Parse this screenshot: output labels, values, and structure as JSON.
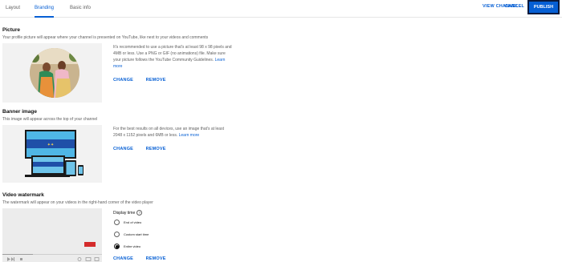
{
  "tabs": [
    {
      "label": "Layout",
      "active": false
    },
    {
      "label": "Branding",
      "active": true
    },
    {
      "label": "Basic info",
      "active": false
    }
  ],
  "top_actions": {
    "view_channel": "VIEW CHANNEL",
    "cancel": "CANCEL",
    "publish": "PUBLISH"
  },
  "picture": {
    "title": "Picture",
    "description": "Your profile picture will appear where your channel is presented on YouTube, like next to your videos and comments",
    "help": "It's recommended to use a picture that's at least 98 x 98 pixels and 4MB or less. Use a PNG or GIF (no animations) file. Make sure your picture follows the YouTube Community Guidelines.",
    "learn_more": "Learn more",
    "change": "CHANGE",
    "remove": "REMOVE"
  },
  "banner": {
    "title": "Banner image",
    "description": "This image will appear across the top of your channel",
    "help": "For the best results on all devices, use an image that's at least 2048 x 1152 pixels and 6MB or less.",
    "learn_more": "Learn more",
    "change": "CHANGE",
    "remove": "REMOVE"
  },
  "watermark": {
    "title": "Video watermark",
    "description": "The watermark will appear on your videos in the right-hand corner of the video player",
    "display_time_label": "Display time",
    "options": [
      {
        "label": "End of video",
        "selected": false
      },
      {
        "label": "Custom start time",
        "selected": false
      },
      {
        "label": "Entire video",
        "selected": true
      }
    ],
    "change": "CHANGE",
    "remove": "REMOVE"
  },
  "colors": {
    "accent": "#065fd4",
    "publish_bg": "#065fd4",
    "secondary_text": "#606060",
    "preview_bg": "#f2f2f2"
  }
}
